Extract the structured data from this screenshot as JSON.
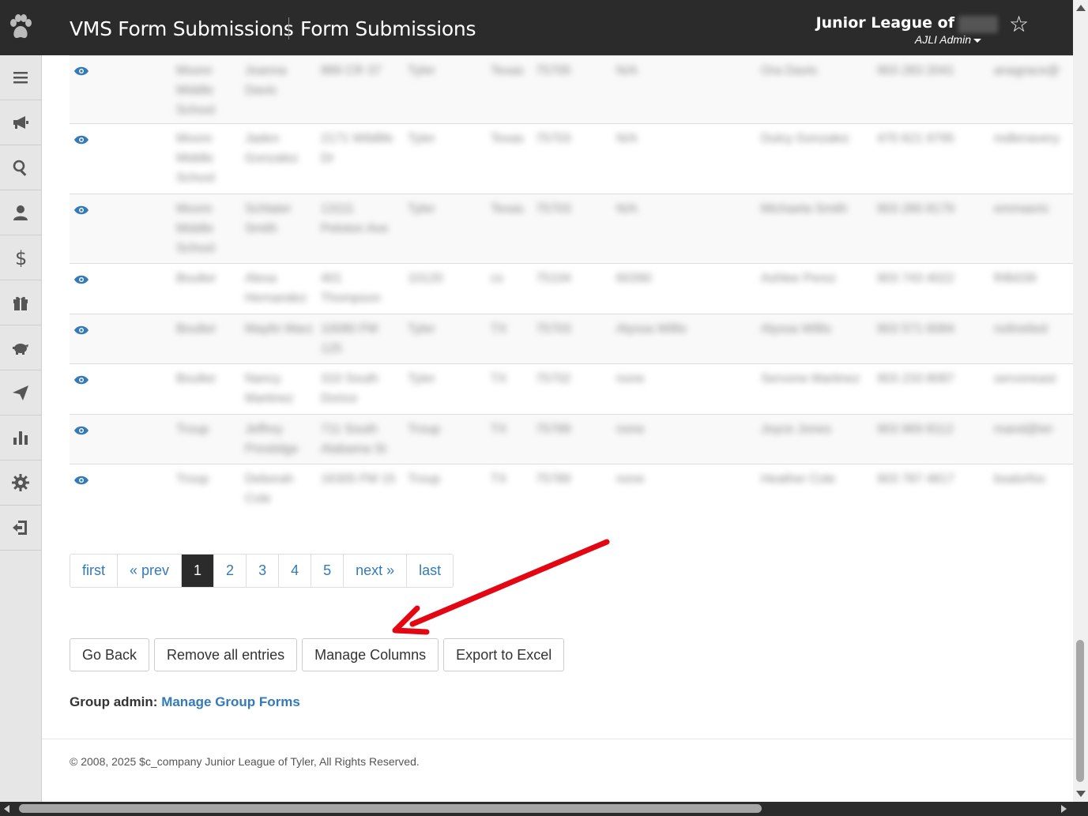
{
  "header": {
    "app_title": "VMS Form Submissions",
    "page_title": "Form Submissions",
    "org_name": "Junior League of",
    "role": "AJLI Admin"
  },
  "sidebar": {
    "items": [
      {
        "icon": "menu-icon"
      },
      {
        "icon": "megaphone-icon"
      },
      {
        "icon": "search-icon"
      },
      {
        "icon": "user-icon"
      },
      {
        "icon": "dollar-icon"
      },
      {
        "icon": "gift-icon"
      },
      {
        "icon": "piggy-bank-icon"
      },
      {
        "icon": "send-icon"
      },
      {
        "icon": "bar-chart-icon"
      },
      {
        "icon": "gear-icon"
      },
      {
        "icon": "logout-icon"
      }
    ]
  },
  "table": {
    "rows": [
      [
        "Moore Middle School",
        "Joanna Davis",
        "889 CR 37",
        "Tyler",
        "Texas",
        "75705",
        "N/A",
        "Ora Davis",
        "903 283 2041",
        "anagrace@"
      ],
      [
        "Moore Middle School",
        "Jaden Gonzalez",
        "2171 Wildlife Dr",
        "Tyler",
        "Texas",
        "75703",
        "N/A",
        "Dulcy Gonzalez",
        "470 621 9795",
        "mdlenavery"
      ],
      [
        "Moore Middle School",
        "Schlater Smith",
        "13111 Peloton Ave",
        "Tyler",
        "Texas",
        "75703",
        "N/A",
        "Michaela Smith",
        "903 280 8179",
        "emmaeric"
      ],
      [
        "Boulter",
        "Alexa Hernandez",
        "401 Thompson",
        "10120",
        "cs",
        "75104",
        "60390",
        "Ashlee Perez",
        "903 743 4022",
        "fhfb039"
      ],
      [
        "Boulter",
        "Maylin Marz",
        "10080 FM 125",
        "Tyler",
        "TX",
        "75703",
        "Alyssa Willis",
        "Alyssa Willis",
        "903 571 6084",
        "nolinelied"
      ],
      [
        "Boulter",
        "Nancy Martinez",
        "310 South Dorice",
        "Tyler",
        "TX",
        "75702",
        "none",
        "Servone Martinez",
        "903 233 8087",
        "servoneast"
      ],
      [
        "Troup",
        "Jeffrey Prestidge",
        "711 South Alabama St",
        "Troup",
        "TX",
        "75789",
        "none",
        "Joyce Jones",
        "903 969 8112",
        "mand@ter"
      ],
      [
        "Troup",
        "Deborah Cole",
        "16305 FM 15",
        "Troup",
        "TX",
        "75789",
        "none",
        "Heather Cole",
        "903 787 4817",
        "bsalorfos"
      ]
    ]
  },
  "pagination": {
    "items": [
      "first",
      "« prev",
      "1",
      "2",
      "3",
      "4",
      "5",
      "next »",
      "last"
    ],
    "active": "1"
  },
  "buttons": {
    "go_back": "Go Back",
    "remove_all": "Remove all entries",
    "manage_columns": "Manage Columns",
    "export_excel": "Export to Excel"
  },
  "group_admin": {
    "label": "Group admin:",
    "link": "Manage Group Forms"
  },
  "footer": {
    "text": "© 2008, 2025 $c_company Junior League of Tyler, All Rights Reserved."
  },
  "colors": {
    "navbar": "#2b2b2b",
    "link": "#337ab7",
    "annotation_arrow": "#e30613"
  }
}
